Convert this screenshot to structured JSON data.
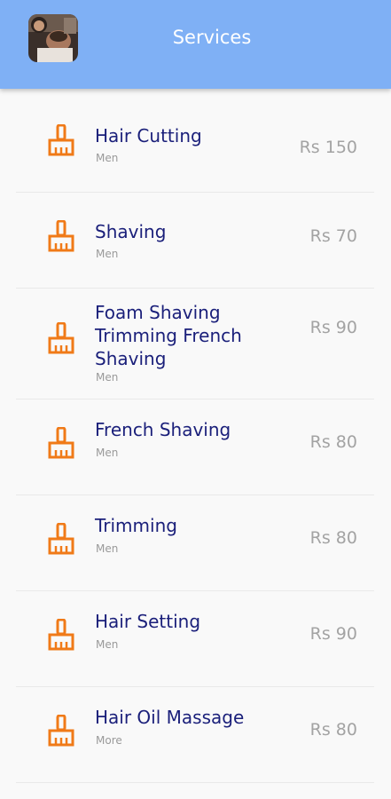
{
  "header": {
    "title": "Services",
    "avatar_alt": "barber-photo"
  },
  "colors": {
    "header_bg": "#7fb0f5",
    "service_name": "#1a1f7a",
    "icon": "#f07a18",
    "price": "#a3a3a3"
  },
  "services": [
    {
      "name": "Hair Cutting",
      "category": "Men",
      "price": "Rs 150",
      "icon": "comb-icon"
    },
    {
      "name": "Shaving",
      "category": "Men",
      "price": "Rs 70",
      "icon": "comb-icon"
    },
    {
      "name": "Foam Shaving Trimming French Shaving",
      "category": "Men",
      "price": "Rs 90",
      "icon": "comb-icon"
    },
    {
      "name": "French Shaving",
      "category": "Men",
      "price": "Rs 80",
      "icon": "comb-icon"
    },
    {
      "name": "Trimming",
      "category": "Men",
      "price": "Rs 80",
      "icon": "comb-icon"
    },
    {
      "name": "Hair Setting",
      "category": "Men",
      "price": "Rs 90",
      "icon": "comb-icon"
    },
    {
      "name": "Hair Oil Massage",
      "category": "More",
      "price": "Rs 80",
      "icon": "comb-icon"
    }
  ]
}
